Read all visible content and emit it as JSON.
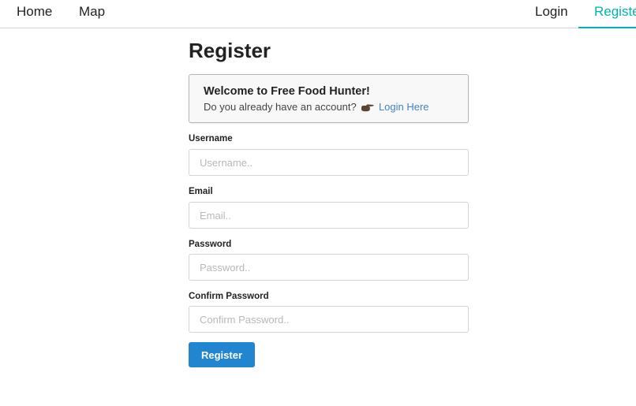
{
  "nav": {
    "home_label": "Home",
    "map_label": "Map",
    "login_label": "Login",
    "register_label": "Registe",
    "active_color": "#00b5ad"
  },
  "page": {
    "title": "Register"
  },
  "welcome": {
    "title": "Welcome to Free Food Hunter!",
    "text": "Do you already have an account?",
    "icon": "pointing-hand-icon",
    "link_label": "Login Here"
  },
  "form": {
    "username": {
      "label": "Username",
      "placeholder": "Username..",
      "value": ""
    },
    "email": {
      "label": "Email",
      "placeholder": "Email..",
      "value": ""
    },
    "password": {
      "label": "Password",
      "placeholder": "Password..",
      "value": ""
    },
    "confirm_password": {
      "label": "Confirm Password",
      "placeholder": "Confirm Password..",
      "value": ""
    },
    "submit_label": "Register",
    "submit_color": "#2185d0"
  }
}
